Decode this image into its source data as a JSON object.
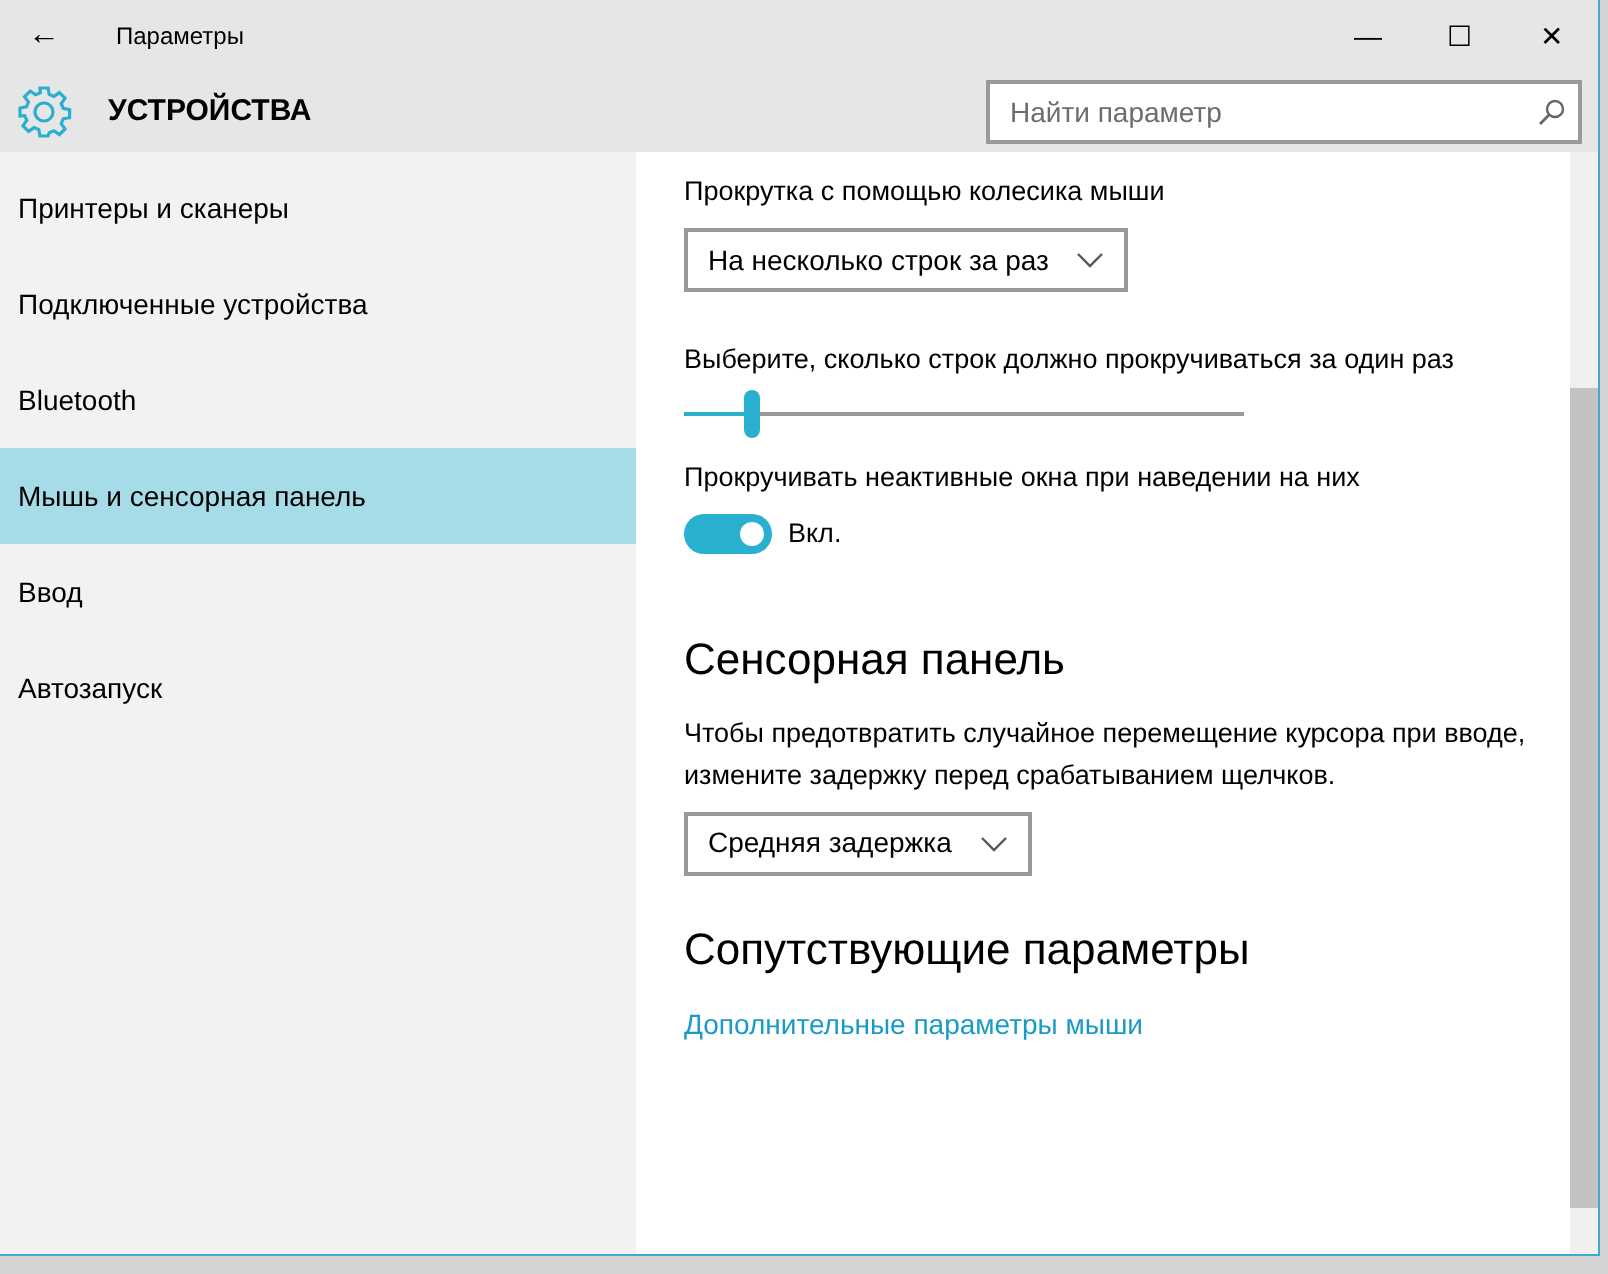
{
  "window": {
    "title": "Параметры",
    "back": "←",
    "controls": [
      "—",
      "☐",
      "✕"
    ]
  },
  "header": {
    "title": "УСТРОЙСТВА",
    "search": {
      "placeholder": "Найти параметр"
    }
  },
  "sidebar": {
    "items": [
      {
        "label": "Принтеры и сканеры",
        "selected": false
      },
      {
        "label": "Подключенные устройства",
        "selected": false
      },
      {
        "label": "Bluetooth",
        "selected": false
      },
      {
        "label": "Мышь и сенсорная панель",
        "selected": true
      },
      {
        "label": "Ввод",
        "selected": false
      },
      {
        "label": "Автозапуск",
        "selected": false
      }
    ]
  },
  "content": [
    {
      "kind": "dropdown",
      "label": "Прокрутка с помощью колесика мыши",
      "value": "На несколько строк за раз"
    },
    {
      "kind": "slider",
      "label": "Выберите, сколько строк должно прокручиваться за один раз",
      "level": 0.12
    },
    {
      "kind": "toggle",
      "label": "Прокручивать неактивные окна при наведении на них",
      "on": true,
      "state_text": "Вкл."
    },
    {
      "kind": "heading",
      "text": "Сенсорная панель"
    },
    {
      "kind": "dropdown",
      "label": "Чтобы предотвратить случайное перемещение курсора при вводе, измените задержку перед срабатыванием щелчков.",
      "value": "Средняя задержка"
    },
    {
      "kind": "heading",
      "text": "Сопутствующие параметры"
    },
    {
      "kind": "link",
      "text": "Дополнительные параметры мыши"
    }
  ]
}
